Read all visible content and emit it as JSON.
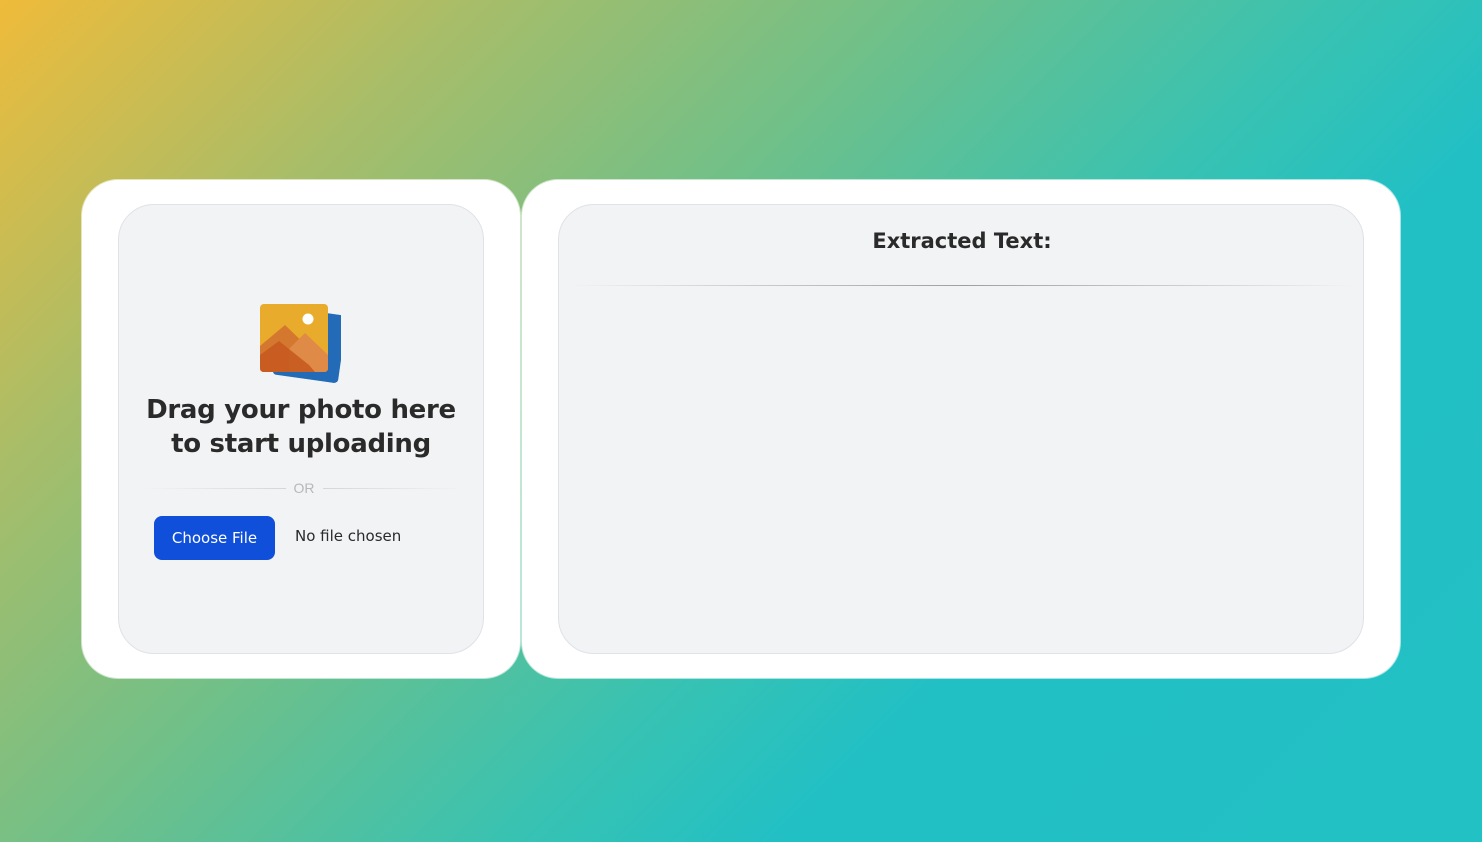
{
  "upload_panel": {
    "icon": "photo-stack-icon",
    "drop_title": "Drag your photo here to start uploading",
    "or_text": "OR",
    "choose_file_label": "Choose File",
    "file_status": "No file chosen"
  },
  "result_panel": {
    "title": "Extracted Text:",
    "output": ""
  },
  "colors": {
    "button": "#0f4fd9",
    "panel_background": "#f2f3f5",
    "card_background": "#ffffff",
    "text": "#2a2a2a",
    "gradient_start": "#efbb3a",
    "gradient_end": "#22c1c4"
  }
}
